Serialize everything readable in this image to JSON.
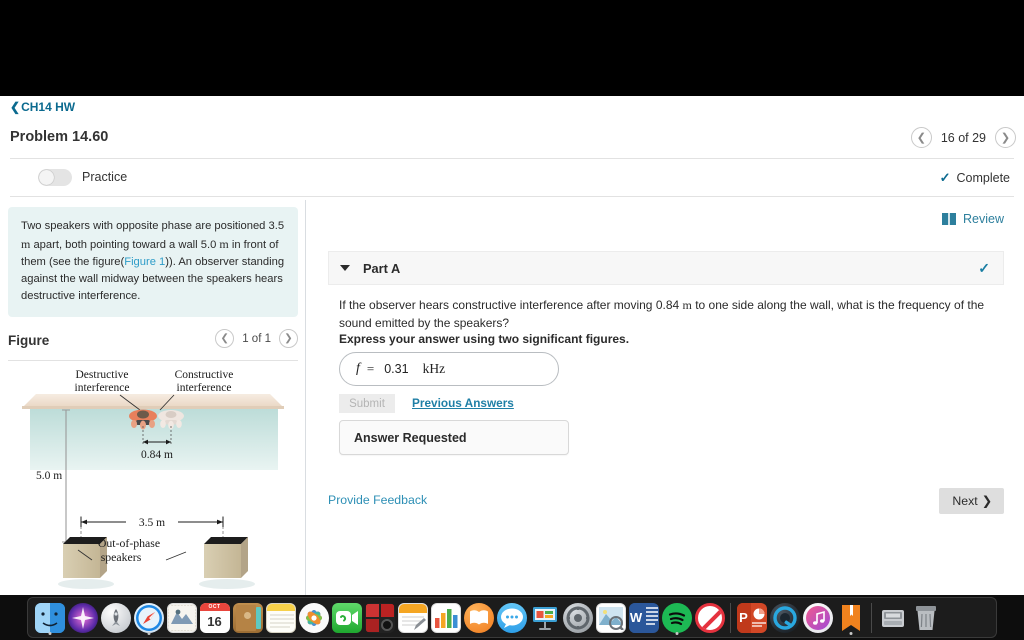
{
  "breadcrumb": {
    "label": "CH14 HW",
    "back_icon": "chevron-left-icon"
  },
  "header": {
    "problem_title": "Problem 14.60",
    "pager": {
      "prev_icon": "chevron-left-icon",
      "next_icon": "chevron-right-icon",
      "label": "16 of 29"
    },
    "practice_label": "Practice",
    "practice_toggle_state": "off",
    "complete_label": "Complete",
    "complete_icon": "check-icon"
  },
  "left_pane": {
    "statement": {
      "part1": "Two speakers with opposite phase are positioned 3.5 ",
      "unit1": "m",
      "part2": " apart, both pointing toward a wall 5.0 ",
      "unit2": "m",
      "part3": " in front of them (see the figure(",
      "figure_link": "Figure 1",
      "part4": ")). An observer standing against the wall midway between the speakers hears destructive interference."
    },
    "figure": {
      "title": "Figure",
      "pager": {
        "prev_icon": "chevron-left-icon",
        "next_icon": "chevron-right-icon",
        "label": "1 of 1"
      },
      "labels": {
        "destructive": "Destructive\ninterference",
        "destructive_line1": "Destructive",
        "destructive_line2": "interference",
        "constructive_line1": "Constructive",
        "constructive_line2": "interference",
        "offset": "0.84 m",
        "distance_to_wall": "5.0 m",
        "speaker_separation": "3.5 m",
        "speakers_line1": "Out-of-phase",
        "speakers_line2": "speakers"
      }
    }
  },
  "right_pane": {
    "review": {
      "label": "Review",
      "icon": "book-icon"
    },
    "part": {
      "title": "Part A",
      "caret_icon": "caret-down-icon",
      "status_icon": "check-icon",
      "question": "If the observer hears constructive interference after moving 0.84 m to one side along the wall, what is the frequency of the sound emitted by the speakers?",
      "question_pre": "If the observer hears constructive interference after moving 0.84 ",
      "question_unit": "m",
      "question_post": " to one side along the wall, what is the frequency of the sound emitted by the speakers?",
      "instruction": "Express your answer using two significant figures.",
      "answer": {
        "symbol": "f",
        "equals": "=",
        "value": "0.31",
        "unit": "kHz"
      },
      "submit_label": "Submit",
      "previous_answers_label": "Previous Answers",
      "answer_requested_label": "Answer Requested"
    },
    "feedback_label": "Provide Feedback",
    "next_label": "Next",
    "next_icon": "chevron-right-icon"
  },
  "dock": {
    "items": [
      {
        "name": "finder",
        "icon": "finder-icon",
        "running": true
      },
      {
        "name": "siri",
        "icon": "siri-icon",
        "running": false
      },
      {
        "name": "launchpad",
        "icon": "launchpad-icon",
        "running": false
      },
      {
        "name": "safari",
        "icon": "safari-icon",
        "running": true
      },
      {
        "name": "mail",
        "icon": "mail-icon",
        "running": false
      },
      {
        "name": "calendar",
        "icon": "calendar-icon",
        "running": false,
        "day": "16",
        "month": "OCT"
      },
      {
        "name": "contacts",
        "icon": "contacts-icon",
        "running": false
      },
      {
        "name": "notes",
        "icon": "notes-icon",
        "running": false
      },
      {
        "name": "photos",
        "icon": "photos-icon",
        "running": false
      },
      {
        "name": "facetime",
        "icon": "facetime-icon",
        "running": false
      },
      {
        "name": "photo-booth",
        "icon": "photo-booth-icon",
        "running": false
      },
      {
        "name": "pages",
        "icon": "pages-icon",
        "running": false
      },
      {
        "name": "numbers",
        "icon": "numbers-icon",
        "running": false
      },
      {
        "name": "ibooks",
        "icon": "ibooks-icon",
        "running": false
      },
      {
        "name": "messages",
        "icon": "messages-icon",
        "running": false
      },
      {
        "name": "keynote",
        "icon": "keynote-icon",
        "running": false
      },
      {
        "name": "system-preferences",
        "icon": "system-preferences-icon",
        "running": false
      },
      {
        "name": "preview",
        "icon": "preview-icon",
        "running": false
      },
      {
        "name": "microsoft-word",
        "icon": "word-icon",
        "running": false,
        "letter": "W"
      },
      {
        "name": "spotify",
        "icon": "spotify-icon",
        "running": true
      },
      {
        "name": "adblock",
        "icon": "no-entry-icon",
        "running": false
      },
      {
        "name": "separator-1",
        "icon": "divider",
        "running": false
      },
      {
        "name": "microsoft-powerpoint",
        "icon": "powerpoint-icon",
        "running": false,
        "letter": "P"
      },
      {
        "name": "quicktime-player",
        "icon": "quicktime-icon",
        "running": false
      },
      {
        "name": "itunes",
        "icon": "itunes-icon",
        "running": false
      },
      {
        "name": "orange-book",
        "icon": "orange-book-icon",
        "running": true
      },
      {
        "name": "separator-2",
        "icon": "divider",
        "running": false
      },
      {
        "name": "downloads",
        "icon": "downloads-folder-icon",
        "running": false
      },
      {
        "name": "trash",
        "icon": "trash-icon",
        "running": false
      }
    ]
  },
  "colors": {
    "accent_blue": "#0b6a8f",
    "link_blue": "#2d8fb5",
    "statement_bg": "#e8f3f3",
    "complete_check": "#0b6a8f"
  }
}
